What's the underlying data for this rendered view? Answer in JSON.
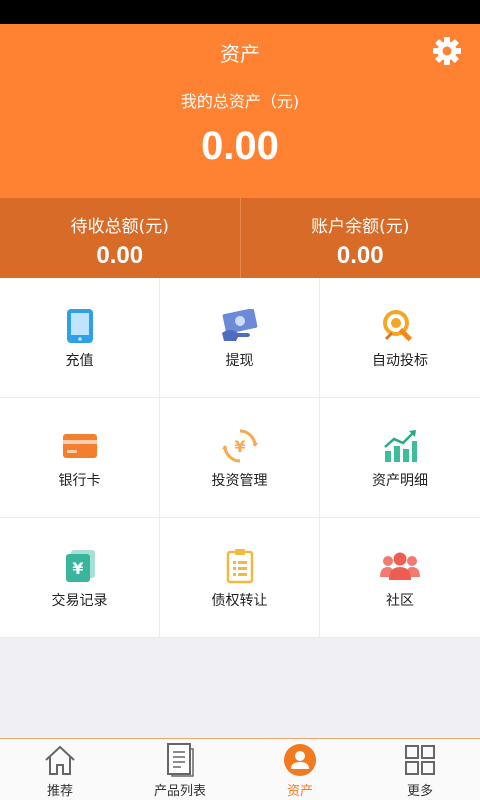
{
  "colors": {
    "accent": "#ff8233",
    "accent_dark": "#d86b27"
  },
  "header": {
    "title": "资产",
    "total_label": "我的总资产（元)",
    "total_value": "0.00",
    "settings_icon": "gear-icon"
  },
  "summary": {
    "pending_label": "待收总额(元)",
    "pending_value": "0.00",
    "balance_label": "账户余额(元)",
    "balance_value": "0.00"
  },
  "grid": [
    {
      "label": "充值",
      "icon": "phone-icon"
    },
    {
      "label": "提现",
      "icon": "cash-icon"
    },
    {
      "label": "自动投标",
      "icon": "target-icon"
    },
    {
      "label": "银行卡",
      "icon": "bank-card-icon"
    },
    {
      "label": "投资管理",
      "icon": "yen-cycle-icon"
    },
    {
      "label": "资产明细",
      "icon": "chart-icon"
    },
    {
      "label": "交易记录",
      "icon": "yen-record-icon"
    },
    {
      "label": "债权转让",
      "icon": "clipboard-icon"
    },
    {
      "label": "社区",
      "icon": "people-icon"
    }
  ],
  "tabs": [
    {
      "label": "推荐",
      "icon": "home-icon"
    },
    {
      "label": "产品列表",
      "icon": "document-icon"
    },
    {
      "label": "资产",
      "icon": "user-icon",
      "active": true
    },
    {
      "label": "更多",
      "icon": "grid-icon"
    }
  ]
}
